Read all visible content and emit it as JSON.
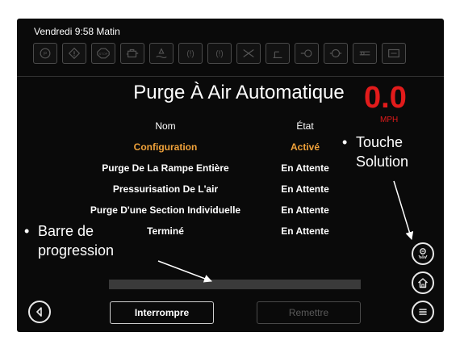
{
  "status_bar": {
    "datetime": "Vendredi 9:58 Matin",
    "icons": [
      "parking-brake-icon",
      "warning-icon",
      "stop-icon",
      "engine-icon",
      "fluid-level-icon",
      "warning-light-icon",
      "warning-light-icon",
      "boom-icon",
      "fluid-level-icon",
      "engine-coolant-icon",
      "filter-icon",
      "hydraulic-icon",
      "battery-icon"
    ]
  },
  "page": {
    "title": "Purge À Air Automatique"
  },
  "speed": {
    "value": "0.0",
    "unit": "MPH",
    "color": "#e21b1b"
  },
  "table": {
    "headers": {
      "name": "Nom",
      "state": "État"
    },
    "rows": [
      {
        "name": "Configuration",
        "state": "Activé",
        "active": true
      },
      {
        "name": "Purge De La Rampe Entière",
        "state": "En Attente"
      },
      {
        "name": "Pressurisation De L'air",
        "state": "En Attente"
      },
      {
        "name": "Purge D'une Section Individuelle",
        "state": "En Attente"
      },
      {
        "name": "Terminé",
        "state": "En Attente"
      }
    ]
  },
  "progress": {
    "fraction": 0.0
  },
  "buttons": {
    "interrupt": "Interrompre",
    "reset": "Remettre"
  },
  "icons": {
    "back": "back-icon",
    "solution": "solution-icon",
    "home": "home-icon",
    "menu": "menu-icon"
  },
  "callouts": {
    "solution_key_line1": "Touche",
    "solution_key_line2": "Solution",
    "progress_bar_line1": "Barre de",
    "progress_bar_line2": "progression"
  },
  "colors": {
    "active": "#f0a23a",
    "speed": "#e21b1b"
  }
}
